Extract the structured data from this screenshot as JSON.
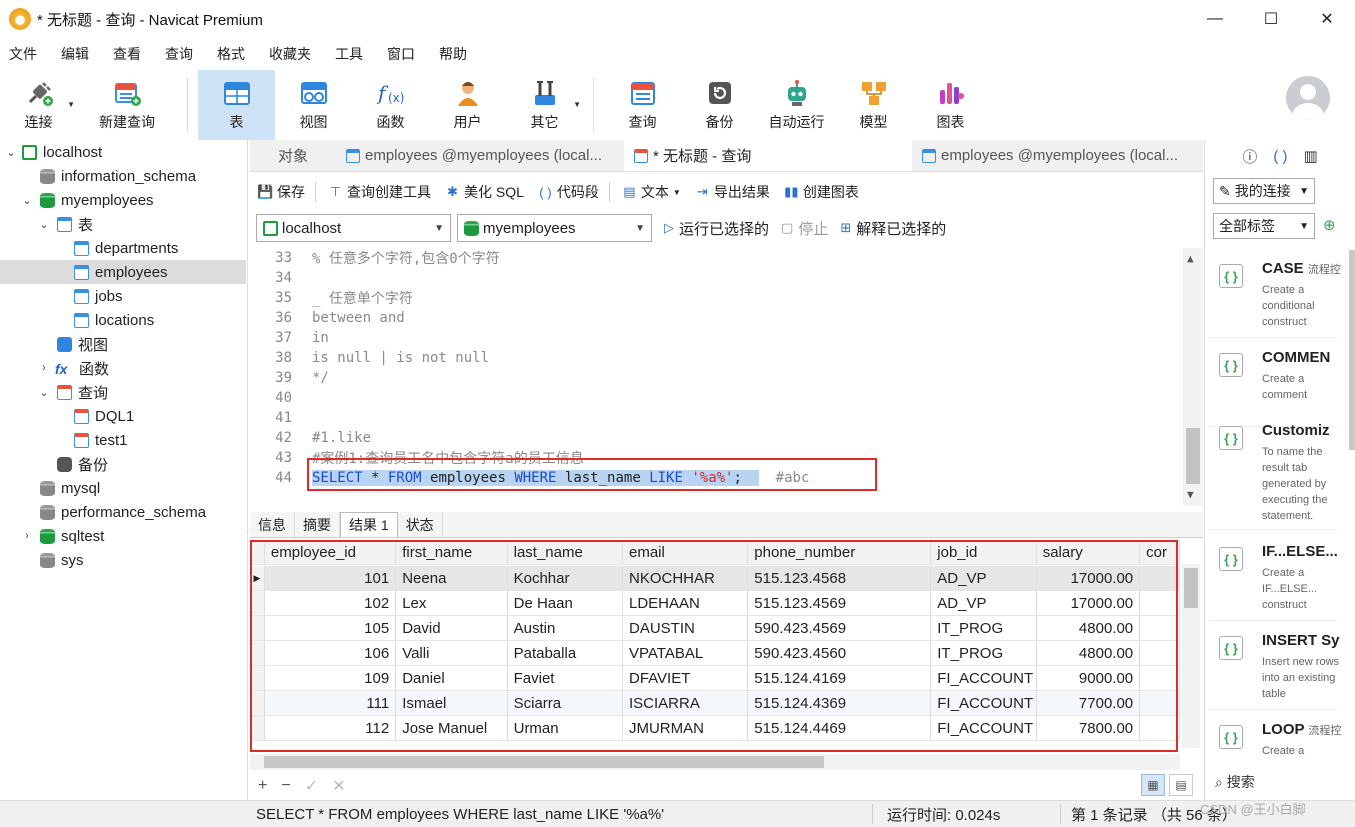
{
  "window": {
    "title": "* 无标题 - 查询 - Navicat Premium",
    "controls": {
      "minimize": "—",
      "maximize": "☐",
      "close": "✕"
    }
  },
  "menu": [
    "文件",
    "编辑",
    "查看",
    "查询",
    "格式",
    "收藏夹",
    "工具",
    "窗口",
    "帮助"
  ],
  "toolbar": {
    "items": [
      {
        "label": "连接",
        "icon": "plug-icon"
      },
      {
        "label": "新建查询",
        "icon": "new-query-icon"
      },
      {
        "label": "表",
        "icon": "table-icon"
      },
      {
        "label": "视图",
        "icon": "view-icon"
      },
      {
        "label": "函数",
        "icon": "function-icon"
      },
      {
        "label": "用户",
        "icon": "user-icon"
      },
      {
        "label": "其它",
        "icon": "tools-icon"
      },
      {
        "label": "查询",
        "icon": "query-icon"
      },
      {
        "label": "备份",
        "icon": "backup-icon"
      },
      {
        "label": "自动运行",
        "icon": "robot-icon"
      },
      {
        "label": "模型",
        "icon": "model-icon"
      },
      {
        "label": "图表",
        "icon": "chart-icon"
      }
    ],
    "active": "表"
  },
  "tree": {
    "connection": "localhost",
    "databases": [
      "information_schema",
      "myemployees"
    ],
    "tables_label": "表",
    "tables": [
      "departments",
      "employees",
      "jobs",
      "locations"
    ],
    "views_label": "视图",
    "functions_label": "函数",
    "queries_label": "查询",
    "queries": [
      "DQL1",
      "test1"
    ],
    "backup_label": "备份",
    "other_databases": [
      "mysql",
      "performance_schema",
      "sqltest",
      "sys"
    ]
  },
  "tabs": {
    "object": "对象",
    "tab1": "employees @myemployees (local...",
    "tab2": "* 无标题 - 查询",
    "tab3": "employees @myemployees (local..."
  },
  "editor_toolbar": {
    "save": "保存",
    "builder": "查询创建工具",
    "beautify": "美化 SQL",
    "snippet": "代码段",
    "text": "文本",
    "export": "导出结果",
    "chart": "创建图表"
  },
  "selectors": {
    "connection": "localhost",
    "database": "myemployees",
    "run": "运行已选择的",
    "stop": "停止",
    "explain": "解释已选择的"
  },
  "code_lines": [
    {
      "n": "33",
      "text": "% 任意多个字符,包含0个字符"
    },
    {
      "n": "34",
      "text": ""
    },
    {
      "n": "35",
      "text": "_ 任意单个字符"
    },
    {
      "n": "36",
      "text": "between and"
    },
    {
      "n": "37",
      "text": "in"
    },
    {
      "n": "38",
      "text": "is null | is not null"
    },
    {
      "n": "39",
      "text": "*/"
    },
    {
      "n": "40",
      "text": ""
    },
    {
      "n": "41",
      "text": ""
    },
    {
      "n": "42",
      "text": "#1.like"
    },
    {
      "n": "43",
      "text": "#案例1:查询员工名中包含字符a的员工信息"
    }
  ],
  "sql_line": {
    "n": "44",
    "kw1": "SELECT",
    "star": " * ",
    "kw2": "FROM",
    "t1": " employees ",
    "kw3": "WHERE",
    "t2": " last_name ",
    "kw4": "LIKE",
    "sp": " ",
    "str": "'%a%'",
    "semi": ";",
    "comment": "#abc"
  },
  "result_tabs": [
    "信息",
    "摘要",
    "结果 1",
    "状态"
  ],
  "grid": {
    "columns": [
      "employee_id",
      "first_name",
      "last_name",
      "email",
      "phone_number",
      "job_id",
      "salary",
      "cor"
    ],
    "rows": [
      [
        "101",
        "Neena",
        "Kochhar",
        "NKOCHHAR",
        "515.123.4568",
        "AD_VP",
        "17000.00"
      ],
      [
        "102",
        "Lex",
        "De Haan",
        "LDEHAAN",
        "515.123.4569",
        "AD_VP",
        "17000.00"
      ],
      [
        "105",
        "David",
        "Austin",
        "DAUSTIN",
        "590.423.4569",
        "IT_PROG",
        "4800.00"
      ],
      [
        "106",
        "Valli",
        "Pataballa",
        "VPATABAL",
        "590.423.4560",
        "IT_PROG",
        "4800.00"
      ],
      [
        "109",
        "Daniel",
        "Faviet",
        "DFAVIET",
        "515.124.4169",
        "FI_ACCOUNT",
        "9000.00"
      ],
      [
        "111",
        "Ismael",
        "Sciarra",
        "ISCIARRA",
        "515.124.4369",
        "FI_ACCOUNT",
        "7700.00"
      ],
      [
        "112",
        "Jose Manuel",
        "Urman",
        "JMURMAN",
        "515.124.4469",
        "FI_ACCOUNT",
        "7800.00"
      ]
    ]
  },
  "grid_tools": {
    "add": "+",
    "remove": "−",
    "apply": "✓",
    "discard": "✕"
  },
  "status": {
    "sql": "SELECT * FROM employees WHERE last_name LIKE '%a%'",
    "runtime": "运行时间: 0.024s",
    "records": "第 1 条记录 （共 56 条）"
  },
  "watermark": "CSDN @王小白脚",
  "right_panel": {
    "conn_filter": "我的连接",
    "tag_filter": "全部标签",
    "search": "搜索",
    "snippets": [
      {
        "title": "CASE",
        "sub": "流程控",
        "desc": "Create a conditional construct"
      },
      {
        "title": "COMMEN",
        "sub": "",
        "desc": "Create a comment"
      },
      {
        "title": "Customiz",
        "sub": "",
        "desc": "To name the result tab generated by executing the statement."
      },
      {
        "title": "IF...ELSE...",
        "sub": "",
        "desc": "Create a IF...ELSE... construct"
      },
      {
        "title": "INSERT Sy",
        "sub": "",
        "desc": "Insert new rows into an existing table"
      },
      {
        "title": "LOOP",
        "sub": "流程控",
        "desc": "Create a"
      }
    ]
  },
  "colors": {
    "accent": "#3a8fe0",
    "highlight_box": "#e02a2a",
    "active_tool": "#cfe3f6",
    "keyword": "#1a4cd0",
    "string": "#d42a2a"
  }
}
